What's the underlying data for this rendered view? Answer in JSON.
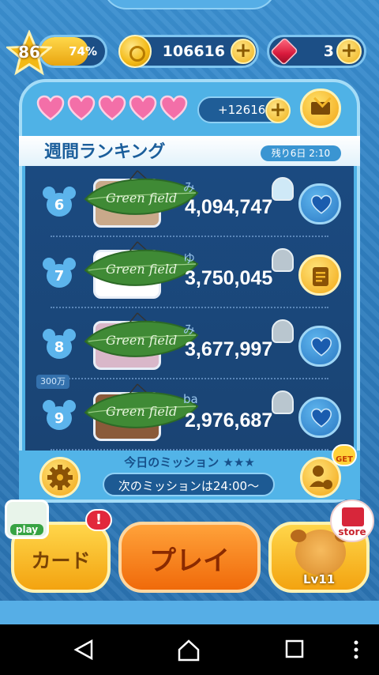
{
  "status": {
    "level": "86",
    "exp_percent": 74,
    "exp_label": "74%",
    "coins": "106616",
    "gems": "3"
  },
  "hearts_count": 5,
  "bonus_coins": "+12616",
  "ranking": {
    "title": "週間ランキング",
    "remaining": "残り6日 2:10",
    "rows": [
      {
        "rank": "6",
        "name": "み",
        "score": "4,094,747",
        "action": "heart"
      },
      {
        "rank": "7",
        "name": "ゆ",
        "score": "3,750,045",
        "action": "document"
      },
      {
        "rank": "8",
        "name": "み",
        "score": "3,677,997",
        "action": "heart"
      },
      {
        "rank": "9",
        "name": "ba",
        "score": "2,976,687",
        "action": "heart"
      }
    ],
    "marker": "300万"
  },
  "mission": {
    "title": "今日のミッション ★★★",
    "next": "次のミッションは24:00〜",
    "get_badge": "GET"
  },
  "buttons": {
    "card": "カード",
    "play": "プレイ",
    "tsum_level": "Lv11",
    "play_badge": "play",
    "store_badge": "store",
    "alert": "!"
  },
  "leaf_text": "Green field",
  "colors": {
    "accent": "#f3a310",
    "play": "#f06a0a",
    "panel": "#4fb2e6",
    "list_bg": "#1b4a80"
  }
}
